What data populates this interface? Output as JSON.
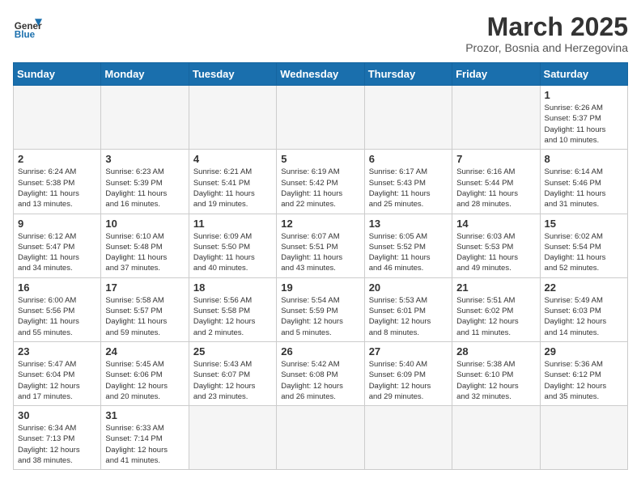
{
  "header": {
    "logo_general": "General",
    "logo_blue": "Blue",
    "month_title": "March 2025",
    "subtitle": "Prozor, Bosnia and Herzegovina"
  },
  "weekdays": [
    "Sunday",
    "Monday",
    "Tuesday",
    "Wednesday",
    "Thursday",
    "Friday",
    "Saturday"
  ],
  "weeks": [
    [
      {
        "day": "",
        "info": ""
      },
      {
        "day": "",
        "info": ""
      },
      {
        "day": "",
        "info": ""
      },
      {
        "day": "",
        "info": ""
      },
      {
        "day": "",
        "info": ""
      },
      {
        "day": "",
        "info": ""
      },
      {
        "day": "1",
        "info": "Sunrise: 6:26 AM\nSunset: 5:37 PM\nDaylight: 11 hours\nand 10 minutes."
      }
    ],
    [
      {
        "day": "2",
        "info": "Sunrise: 6:24 AM\nSunset: 5:38 PM\nDaylight: 11 hours\nand 13 minutes."
      },
      {
        "day": "3",
        "info": "Sunrise: 6:23 AM\nSunset: 5:39 PM\nDaylight: 11 hours\nand 16 minutes."
      },
      {
        "day": "4",
        "info": "Sunrise: 6:21 AM\nSunset: 5:41 PM\nDaylight: 11 hours\nand 19 minutes."
      },
      {
        "day": "5",
        "info": "Sunrise: 6:19 AM\nSunset: 5:42 PM\nDaylight: 11 hours\nand 22 minutes."
      },
      {
        "day": "6",
        "info": "Sunrise: 6:17 AM\nSunset: 5:43 PM\nDaylight: 11 hours\nand 25 minutes."
      },
      {
        "day": "7",
        "info": "Sunrise: 6:16 AM\nSunset: 5:44 PM\nDaylight: 11 hours\nand 28 minutes."
      },
      {
        "day": "8",
        "info": "Sunrise: 6:14 AM\nSunset: 5:46 PM\nDaylight: 11 hours\nand 31 minutes."
      }
    ],
    [
      {
        "day": "9",
        "info": "Sunrise: 6:12 AM\nSunset: 5:47 PM\nDaylight: 11 hours\nand 34 minutes."
      },
      {
        "day": "10",
        "info": "Sunrise: 6:10 AM\nSunset: 5:48 PM\nDaylight: 11 hours\nand 37 minutes."
      },
      {
        "day": "11",
        "info": "Sunrise: 6:09 AM\nSunset: 5:50 PM\nDaylight: 11 hours\nand 40 minutes."
      },
      {
        "day": "12",
        "info": "Sunrise: 6:07 AM\nSunset: 5:51 PM\nDaylight: 11 hours\nand 43 minutes."
      },
      {
        "day": "13",
        "info": "Sunrise: 6:05 AM\nSunset: 5:52 PM\nDaylight: 11 hours\nand 46 minutes."
      },
      {
        "day": "14",
        "info": "Sunrise: 6:03 AM\nSunset: 5:53 PM\nDaylight: 11 hours\nand 49 minutes."
      },
      {
        "day": "15",
        "info": "Sunrise: 6:02 AM\nSunset: 5:54 PM\nDaylight: 11 hours\nand 52 minutes."
      }
    ],
    [
      {
        "day": "16",
        "info": "Sunrise: 6:00 AM\nSunset: 5:56 PM\nDaylight: 11 hours\nand 55 minutes."
      },
      {
        "day": "17",
        "info": "Sunrise: 5:58 AM\nSunset: 5:57 PM\nDaylight: 11 hours\nand 59 minutes."
      },
      {
        "day": "18",
        "info": "Sunrise: 5:56 AM\nSunset: 5:58 PM\nDaylight: 12 hours\nand 2 minutes."
      },
      {
        "day": "19",
        "info": "Sunrise: 5:54 AM\nSunset: 5:59 PM\nDaylight: 12 hours\nand 5 minutes."
      },
      {
        "day": "20",
        "info": "Sunrise: 5:53 AM\nSunset: 6:01 PM\nDaylight: 12 hours\nand 8 minutes."
      },
      {
        "day": "21",
        "info": "Sunrise: 5:51 AM\nSunset: 6:02 PM\nDaylight: 12 hours\nand 11 minutes."
      },
      {
        "day": "22",
        "info": "Sunrise: 5:49 AM\nSunset: 6:03 PM\nDaylight: 12 hours\nand 14 minutes."
      }
    ],
    [
      {
        "day": "23",
        "info": "Sunrise: 5:47 AM\nSunset: 6:04 PM\nDaylight: 12 hours\nand 17 minutes."
      },
      {
        "day": "24",
        "info": "Sunrise: 5:45 AM\nSunset: 6:06 PM\nDaylight: 12 hours\nand 20 minutes."
      },
      {
        "day": "25",
        "info": "Sunrise: 5:43 AM\nSunset: 6:07 PM\nDaylight: 12 hours\nand 23 minutes."
      },
      {
        "day": "26",
        "info": "Sunrise: 5:42 AM\nSunset: 6:08 PM\nDaylight: 12 hours\nand 26 minutes."
      },
      {
        "day": "27",
        "info": "Sunrise: 5:40 AM\nSunset: 6:09 PM\nDaylight: 12 hours\nand 29 minutes."
      },
      {
        "day": "28",
        "info": "Sunrise: 5:38 AM\nSunset: 6:10 PM\nDaylight: 12 hours\nand 32 minutes."
      },
      {
        "day": "29",
        "info": "Sunrise: 5:36 AM\nSunset: 6:12 PM\nDaylight: 12 hours\nand 35 minutes."
      }
    ],
    [
      {
        "day": "30",
        "info": "Sunrise: 6:34 AM\nSunset: 7:13 PM\nDaylight: 12 hours\nand 38 minutes."
      },
      {
        "day": "31",
        "info": "Sunrise: 6:33 AM\nSunset: 7:14 PM\nDaylight: 12 hours\nand 41 minutes."
      },
      {
        "day": "",
        "info": ""
      },
      {
        "day": "",
        "info": ""
      },
      {
        "day": "",
        "info": ""
      },
      {
        "day": "",
        "info": ""
      },
      {
        "day": "",
        "info": ""
      }
    ]
  ]
}
